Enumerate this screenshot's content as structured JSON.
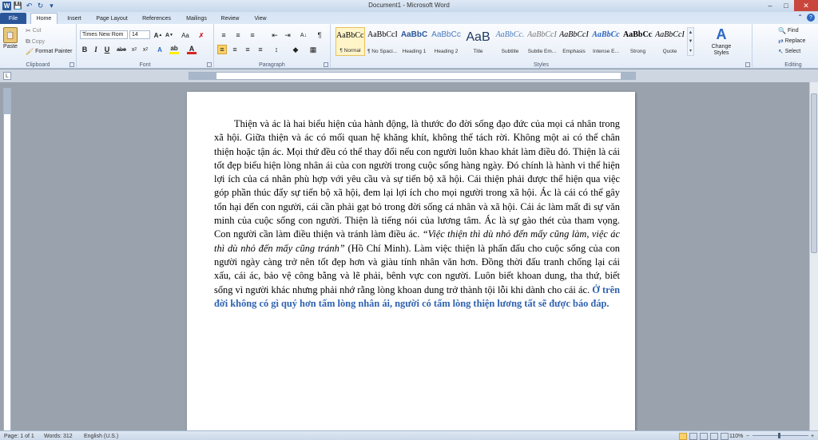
{
  "window": {
    "title": "Document1 - Microsoft Word"
  },
  "tabs": [
    "File",
    "Home",
    "Insert",
    "Page Layout",
    "References",
    "Mailings",
    "Review",
    "View"
  ],
  "clipboard": {
    "paste": "Paste",
    "cut": "Cut",
    "copy": "Copy",
    "format_painter": "Format Painter",
    "label": "Clipboard"
  },
  "font": {
    "family": "Times New Rom",
    "size": "14",
    "label": "Font"
  },
  "paragraph": {
    "label": "Paragraph"
  },
  "styles": {
    "items": [
      {
        "preview": "AaBbCcI",
        "name": "¶ Normal"
      },
      {
        "preview": "AaBbCcI",
        "name": "¶ No Spaci..."
      },
      {
        "preview": "AaBbC",
        "name": "Heading 1"
      },
      {
        "preview": "AaBbCc",
        "name": "Heading 2"
      },
      {
        "preview": "AaB",
        "name": "Title"
      },
      {
        "preview": "AaBbCc.",
        "name": "Subtitle"
      },
      {
        "preview": "AaBbCcI",
        "name": "Subtle Em..."
      },
      {
        "preview": "AaBbCcI",
        "name": "Emphasis"
      },
      {
        "preview": "AaBbCc",
        "name": "Intense E..."
      },
      {
        "preview": "AaBbCcI",
        "name": "Strong"
      },
      {
        "preview": "AaBbCcI",
        "name": "Quote"
      }
    ],
    "change_styles": "Change Styles",
    "label": "Styles"
  },
  "editing": {
    "find": "Find",
    "replace": "Replace",
    "select": "Select",
    "label": "Editing"
  },
  "document": {
    "para_part1": "Thiện và ác là hai biểu hiện của hành động, là thước đo đời sống đạo đức của mọi cá nhân trong xã hội. Giữa thiện và ác có mối quan hệ khăng khít, không thể tách rời. Không một ai có thể chân thiện hoặc tận ác. Mọi thứ đều có thể thay đổi nếu con người luôn khao khát làm điều đó. Thiện là cái tốt đẹp biểu hiện lòng nhân ái của con người trong cuộc sống hàng ngày. Đó chính là hành vi thể hiện lợi ích của cá nhân phù hợp với yêu cầu và sự tiến bộ xã hội. Cái thiện phải được thể hiện qua việc góp phần thúc đẩy sự tiến bộ xã hội, đem lại lợi ích cho mọi người trong xã hội. Ác là cái có thể gây tổn hại đến con người, cái cần phải gạt bỏ trong đời sống cá nhân và xã hội. Cái ác làm mất đi sự văn minh của cuộc sống con người. Thiện là tiếng nói của lương tâm. Ác là sự gào thét của tham vọng. Con người cần làm điều thiện và tránh làm điều ác. ",
    "quote": "“Việc thiện thì dù nhỏ đến mấy cũng làm, việc ác thì dù nhỏ đến mấy cũng tránh”",
    "para_part2": " (Hồ Chí Minh). Làm việc thiện là phấn đấu cho cuộc sống của con người ngày càng trở nên tốt đẹp hơn và giàu tính nhân văn hơn. Đồng thời đấu tranh chống lại cái xấu, cái ác, bảo vệ công bằng và lẽ phải, bênh vực con người. Luôn biết khoan dung, tha thứ, biết sống vì người khác nhưng phải nhớ rằng lòng khoan dung trở thành tội lỗi khi dành cho cái ác. ",
    "highlight": "Ở trên đời không có gì quý hơn tấm lòng nhân ái, người có tấm lòng thiện lương tất sẽ được báo đáp."
  },
  "status": {
    "page": "Page: 1 of 1",
    "words": "Words: 312",
    "language": "English (U.S.)",
    "zoom": "110%"
  },
  "colors": {
    "accent": "#2a5699",
    "highlight_text": "#2f62b0",
    "close_button": "#c9463d"
  }
}
